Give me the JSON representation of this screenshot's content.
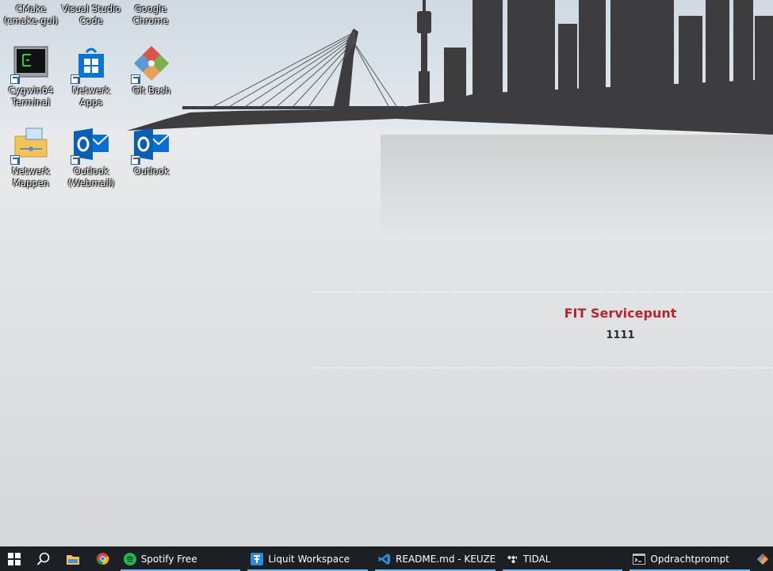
{
  "desktop": {
    "top_row_partial": [
      {
        "label": "CMake (cmake-gui)"
      },
      {
        "label": "Visual Studio Code"
      },
      {
        "label": "Google Chrome"
      }
    ],
    "icons": [
      {
        "label": "Cygwin64 Terminal",
        "icon": "cygwin-terminal-icon"
      },
      {
        "label": "Netwerk Apps",
        "icon": "store-icon"
      },
      {
        "label": "Git Bash",
        "icon": "git-icon"
      },
      {
        "label": "Netwerk Mappen",
        "icon": "network-folder-icon"
      },
      {
        "label": "Outlook (Webmail)",
        "icon": "outlook-icon"
      },
      {
        "label": "Outlook",
        "icon": "outlook-icon"
      }
    ]
  },
  "info_panel": {
    "title": "FIT Servicepunt",
    "number": "1111"
  },
  "taskbar": {
    "apps": [
      {
        "label": "Spotify Free",
        "icon": "spotify-icon"
      },
      {
        "label": "Liquit Workspace",
        "icon": "liquit-icon"
      },
      {
        "label": "README.md - KEUZE...",
        "icon": "vscode-icon"
      },
      {
        "label": "TIDAL",
        "icon": "tidal-icon"
      },
      {
        "label": "Opdrachtprompt",
        "icon": "cmd-icon"
      }
    ]
  },
  "colors": {
    "taskbar_bg": "#1c1f23",
    "accent_underline": "#76b9ed",
    "title_red": "#b0282f",
    "skyline": "#3d3d3f"
  }
}
